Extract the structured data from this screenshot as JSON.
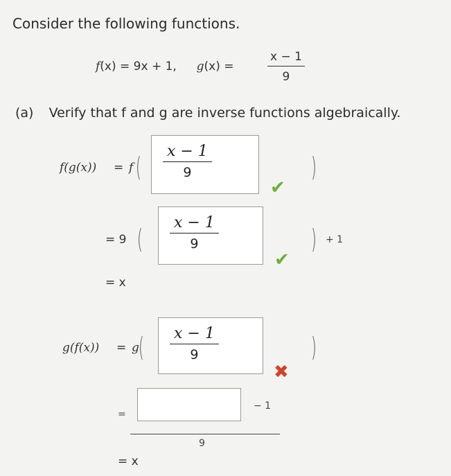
{
  "heading": "Consider the following functions.",
  "definitions": {
    "f_lhs": "f",
    "f_arg": "(x) = 9x + 1,",
    "g_lhs": "g",
    "g_arg": "(x) =",
    "g_num": "x − 1",
    "g_den": "9"
  },
  "part_a": {
    "label": "(a)",
    "prompt": "Verify that f and g are inverse functions algebraically."
  },
  "fg": {
    "lhs": "f(g(x))",
    "eq": "=",
    "outer_f": "f",
    "open_paren": "(",
    "close_paren": ")",
    "box1": {
      "num": "x − 1",
      "den": "9",
      "status": "correct"
    },
    "step2_prefix": "= 9",
    "box2": {
      "num": "x − 1",
      "den": "9",
      "status": "correct"
    },
    "step2_suffix": "+ 1",
    "result": "= x"
  },
  "gf": {
    "lhs": "g(f(x))",
    "eq": "=",
    "outer_g": "g",
    "open_paren": "(",
    "close_paren": ")",
    "box3": {
      "num": "x − 1",
      "den": "9",
      "status": "incorrect"
    },
    "step2_prefix": "=",
    "box4": {
      "value": ""
    },
    "step2_suffix": "− 1",
    "step2_den": "9",
    "result": "= x"
  },
  "icons": {
    "correct": "check-icon",
    "incorrect": "cross-icon"
  },
  "colors": {
    "correct": "#6fae3e",
    "incorrect": "#d0432b",
    "box_border": "#9a9a9a"
  }
}
